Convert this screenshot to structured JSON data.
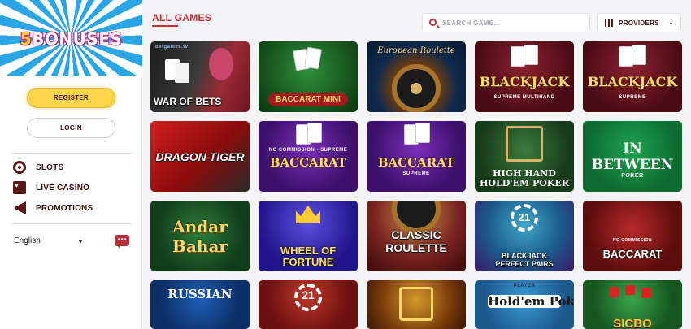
{
  "sidebar": {
    "logo": {
      "prefix": "5",
      "word": "BONUSES"
    },
    "register_label": "REGISTER",
    "login_label": "LOGIN",
    "menu": [
      {
        "label": "SLOTS",
        "icon": "slots-icon"
      },
      {
        "label": "LIVE CASINO",
        "icon": "live-casino-icon"
      },
      {
        "label": "PROMOTIONS",
        "icon": "megaphone-icon"
      }
    ],
    "language": "English"
  },
  "header": {
    "title": "ALL GAMES",
    "search_placeholder": "SEARCH GAME...",
    "providers_label": "PROVIDERS"
  },
  "games": [
    {
      "title": "WAR OF BETS",
      "sub": "betgames.tv"
    },
    {
      "title": "BACCARAT MINI",
      "sub": ""
    },
    {
      "title": "European Roulette",
      "sub": ""
    },
    {
      "title": "BLACKJACK",
      "sub": "SUPREME MULTIHAND"
    },
    {
      "title": "BLACKJACK",
      "sub": "SUPREME"
    },
    {
      "title": "DRAGON TIGER",
      "sub": ""
    },
    {
      "title": "BACCARAT",
      "sub": "NO COMMISSION · SUPREME"
    },
    {
      "title": "BACCARAT",
      "sub": "SUPREME"
    },
    {
      "title": "HIGH HAND HOLD'EM POKER",
      "sub": ""
    },
    {
      "title": "IN BETWEEN",
      "sub": "POKER"
    },
    {
      "title": "Andar Bahar",
      "sub": ""
    },
    {
      "title": "WHEEL OF FORTUNE",
      "sub": ""
    },
    {
      "title": "CLASSIC ROULETTE",
      "sub": ""
    },
    {
      "title": "BLACKJACK PERFECT PAIRS",
      "sub": "21"
    },
    {
      "title": "BACCARAT",
      "sub": "NO COMMISSION"
    },
    {
      "title": "RUSSIAN",
      "sub": ""
    },
    {
      "title": "21",
      "sub": ""
    },
    {
      "title": "",
      "sub": ""
    },
    {
      "title": "Hold'em Poker",
      "sub": "PLAYER"
    },
    {
      "title": "SICBO",
      "sub": ""
    }
  ],
  "colors": {
    "accent": "#c92b34",
    "register_bg": "#ffd54a",
    "text_dark": "#3a0d0d"
  }
}
